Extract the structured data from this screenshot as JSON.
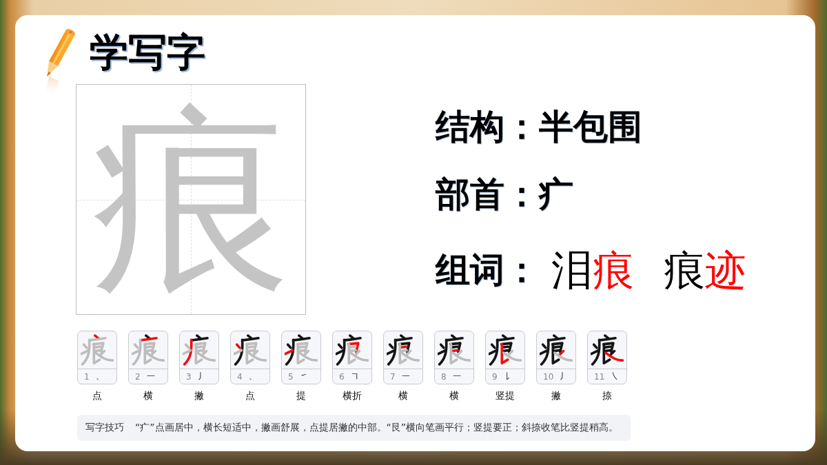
{
  "title": "学写字",
  "character": {
    "glyph": "痕"
  },
  "info": [
    {
      "kind": "text",
      "label": "结构：",
      "value": "半包围"
    },
    {
      "kind": "text",
      "label": "部首：",
      "value": "疒"
    },
    {
      "kind": "words",
      "label": "组词：",
      "words": [
        {
          "chars": [
            {
              "text": "泪",
              "highlighted": false
            },
            {
              "text": "痕",
              "highlighted": true
            }
          ]
        },
        {
          "chars": [
            {
              "text": "痕",
              "highlighted": false
            },
            {
              "text": "迹",
              "highlighted": true
            }
          ]
        }
      ]
    }
  ],
  "strokes": [
    {
      "number": "1",
      "symbol": "、",
      "name": "点"
    },
    {
      "number": "2",
      "symbol": "一",
      "name": "横"
    },
    {
      "number": "3",
      "symbol": "丿",
      "name": "撇"
    },
    {
      "number": "4",
      "symbol": "、",
      "name": "点"
    },
    {
      "number": "5",
      "symbol": "㇀",
      "name": "提"
    },
    {
      "number": "6",
      "symbol": "㇕",
      "name": "横折"
    },
    {
      "number": "7",
      "symbol": "一",
      "name": "横"
    },
    {
      "number": "8",
      "symbol": "一",
      "name": "横"
    },
    {
      "number": "9",
      "symbol": "㇙",
      "name": "竖提"
    },
    {
      "number": "10",
      "symbol": "丿",
      "name": "撇"
    },
    {
      "number": "11",
      "symbol": "㇏",
      "name": "捺"
    }
  ],
  "tip": {
    "label": "写字技巧",
    "text": "“疒”点画居中，横长短适中，撇画舒展，点提居撇的中部。“艮”横向笔画平行；竖提要正；斜捺收笔比竖提稍高。"
  }
}
